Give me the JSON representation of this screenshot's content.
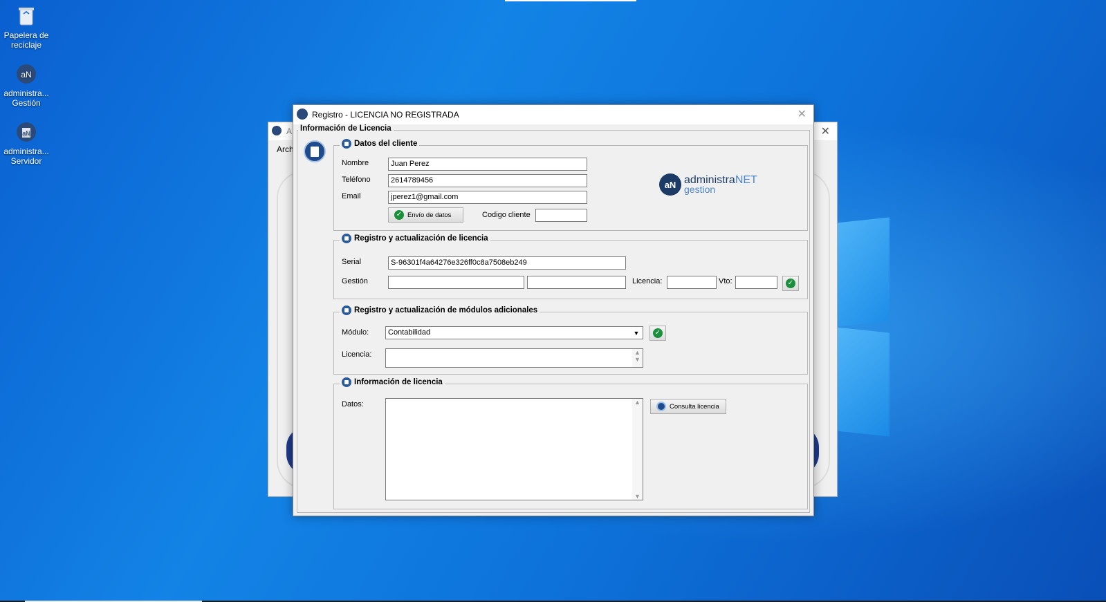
{
  "desktop": {
    "icons": [
      {
        "label_line1": "Papelera de",
        "label_line2": "reciclaje",
        "icon": "recycle-bin-icon"
      },
      {
        "label_line1": "administra...",
        "label_line2": "Gestión",
        "icon": "administranet-icon"
      },
      {
        "label_line1": "administra...",
        "label_line2": "Servidor",
        "icon": "administranet-server-icon"
      }
    ]
  },
  "back_window": {
    "title_short": "A",
    "menu_first": "Arch"
  },
  "dialog": {
    "title": "Registro - LICENCIA NO REGISTRADA",
    "outer_legend": "Información de Licencia",
    "cliente": {
      "legend": "Datos del cliente",
      "nombre_label": "Nombre",
      "nombre_value": "Juan Perez",
      "telefono_label": "Teléfono",
      "telefono_value": "2614789456",
      "email_label": "Email",
      "email_value": "jperez1@gmail.com",
      "envio_button": "Envío de datos",
      "codigo_label": "Codigo cliente",
      "codigo_value": ""
    },
    "logo": {
      "brand": "administra",
      "brand_suffix": "NET",
      "sub": "gestion",
      "mark": "aN"
    },
    "registro": {
      "legend": "Registro y actualización de licencia",
      "serial_label": "Serial",
      "serial_value": "S-96301f4a64276e326ff0c8a7508eb249",
      "gestion_label": "Gestión",
      "gestion_value1": "",
      "gestion_value2": "",
      "licencia_label": "Licencia:",
      "licencia_value": "",
      "vto_label": "Vto:",
      "vto_value": ""
    },
    "modulos": {
      "legend": "Registro y actualización de módulos adicionales",
      "modulo_label": "Módulo:",
      "modulo_selected": "Contabilidad",
      "licencia_label": "Licencia:",
      "licencia_value": ""
    },
    "info": {
      "legend": "Información de licencia",
      "datos_label": "Datos:",
      "datos_value": "",
      "consulta_button": "Consulta licencia"
    }
  }
}
